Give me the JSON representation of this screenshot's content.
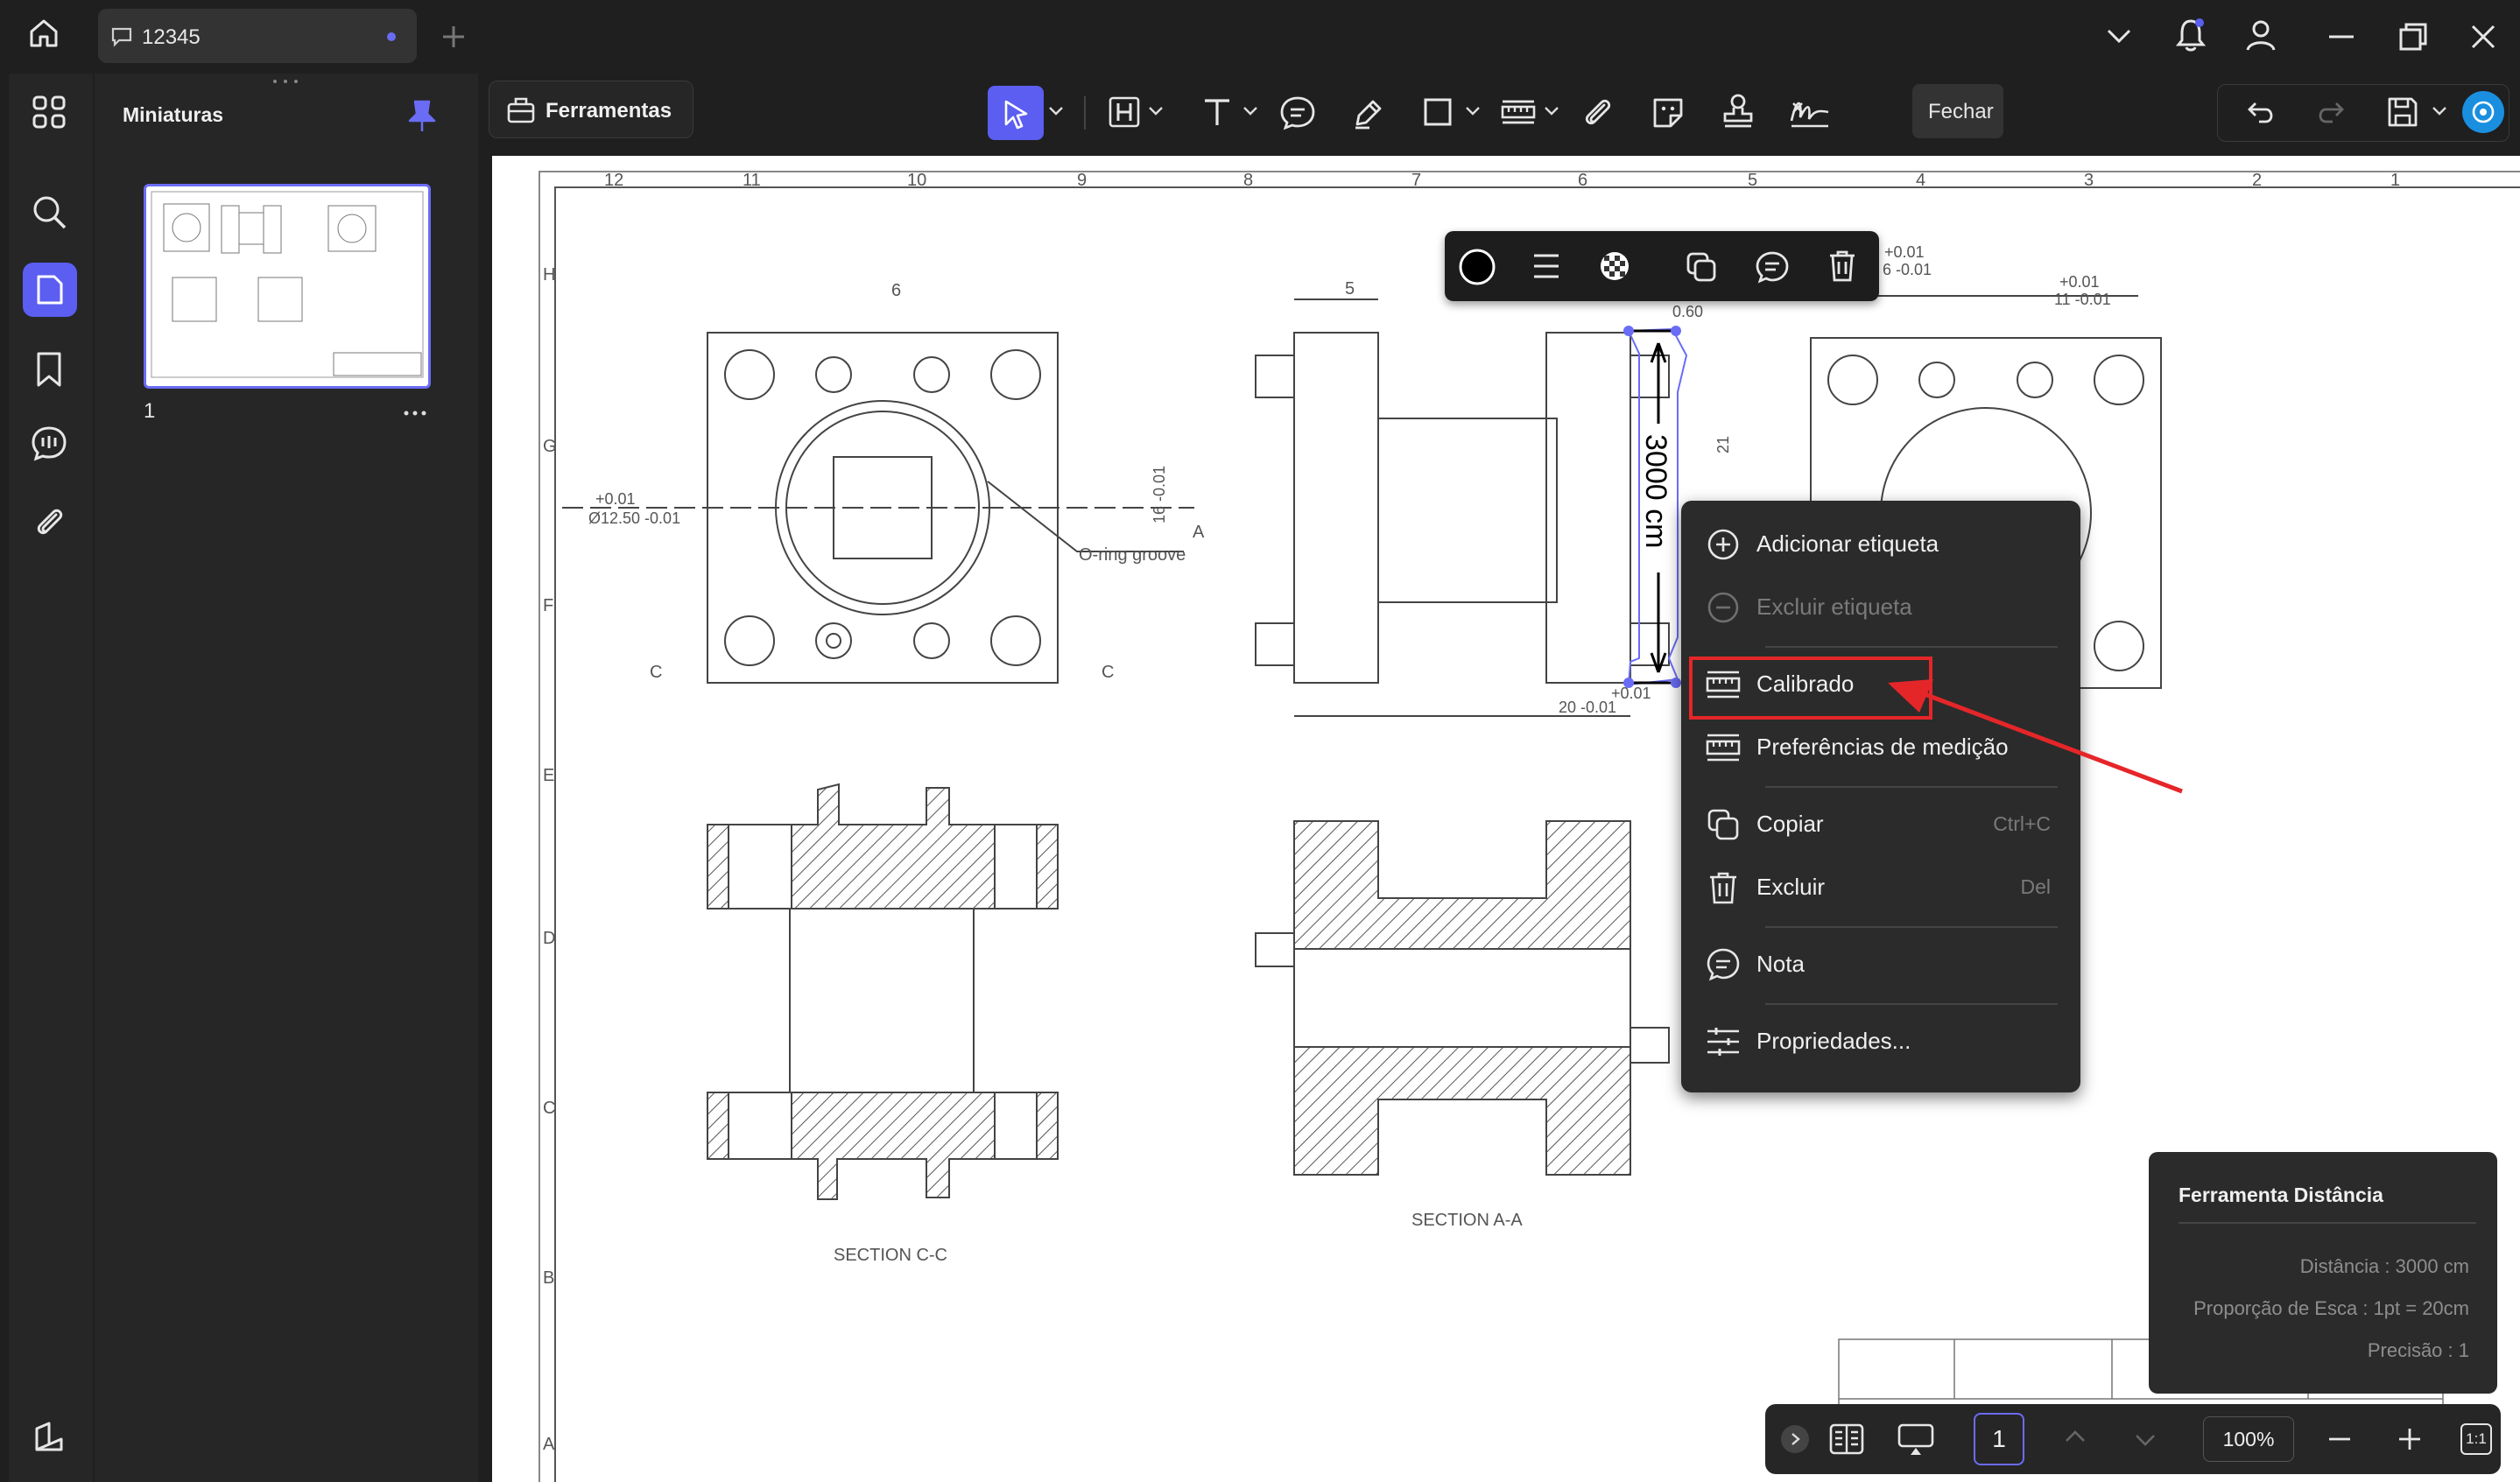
{
  "tab": {
    "title": "12345"
  },
  "panel": {
    "title": "Miniaturas",
    "page_number": "1"
  },
  "toolbar": {
    "tools_label": "Ferramentas",
    "close_label": "Fechar"
  },
  "measurement": {
    "label": "3000 cm"
  },
  "drawing": {
    "column_numbers": [
      "12",
      "11",
      "10",
      "9",
      "8",
      "7",
      "6",
      "5",
      "4",
      "3",
      "2",
      "1"
    ],
    "row_letters": [
      "H",
      "G",
      "F",
      "E",
      "D",
      "C",
      "B",
      "A"
    ],
    "section_c": "SECTION C-C",
    "section_a": "SECTION A-A",
    "oring": "O-ring groove",
    "dim_6": "6",
    "dim_5": "5",
    "dim_12_50": "Ø12.50 -0.01",
    "dim_12_50_tol": "+0.01",
    "dim_16": "16 -0.01",
    "dim_20": "20 -0.01",
    "dim_11": "11 -0.01",
    "dim_6_right": "6 -0.01",
    "dim_21": "21",
    "dim_060": "0.60",
    "tol_plus": "+0.01",
    "mark_c": "C",
    "mark_a": "A"
  },
  "context_menu": {
    "items": [
      {
        "label": "Adicionar etiqueta",
        "shortcut": "",
        "disabled": false
      },
      {
        "label": "Excluir etiqueta",
        "shortcut": "",
        "disabled": true
      },
      {
        "label": "Calibrado",
        "shortcut": "",
        "disabled": false
      },
      {
        "label": "Preferências de medição",
        "shortcut": "",
        "disabled": false
      },
      {
        "label": "Copiar",
        "shortcut": "Ctrl+C",
        "disabled": false
      },
      {
        "label": "Excluir",
        "shortcut": "Del",
        "disabled": false
      },
      {
        "label": "Nota",
        "shortcut": "",
        "disabled": false
      },
      {
        "label": "Propriedades...",
        "shortcut": "",
        "disabled": false
      }
    ]
  },
  "info_panel": {
    "title": "Ferramenta Distância",
    "distance": "Distância : 3000 cm",
    "scale": "Proporção de Esca : 1pt = 20cm",
    "precision": "Precisão : 1"
  },
  "bottom_bar": {
    "page": "1",
    "zoom": "100%",
    "fit_label": "1:1"
  },
  "colors": {
    "accent": "#5b5ef0",
    "highlight": "#e52629",
    "arrow": "#e52629"
  }
}
